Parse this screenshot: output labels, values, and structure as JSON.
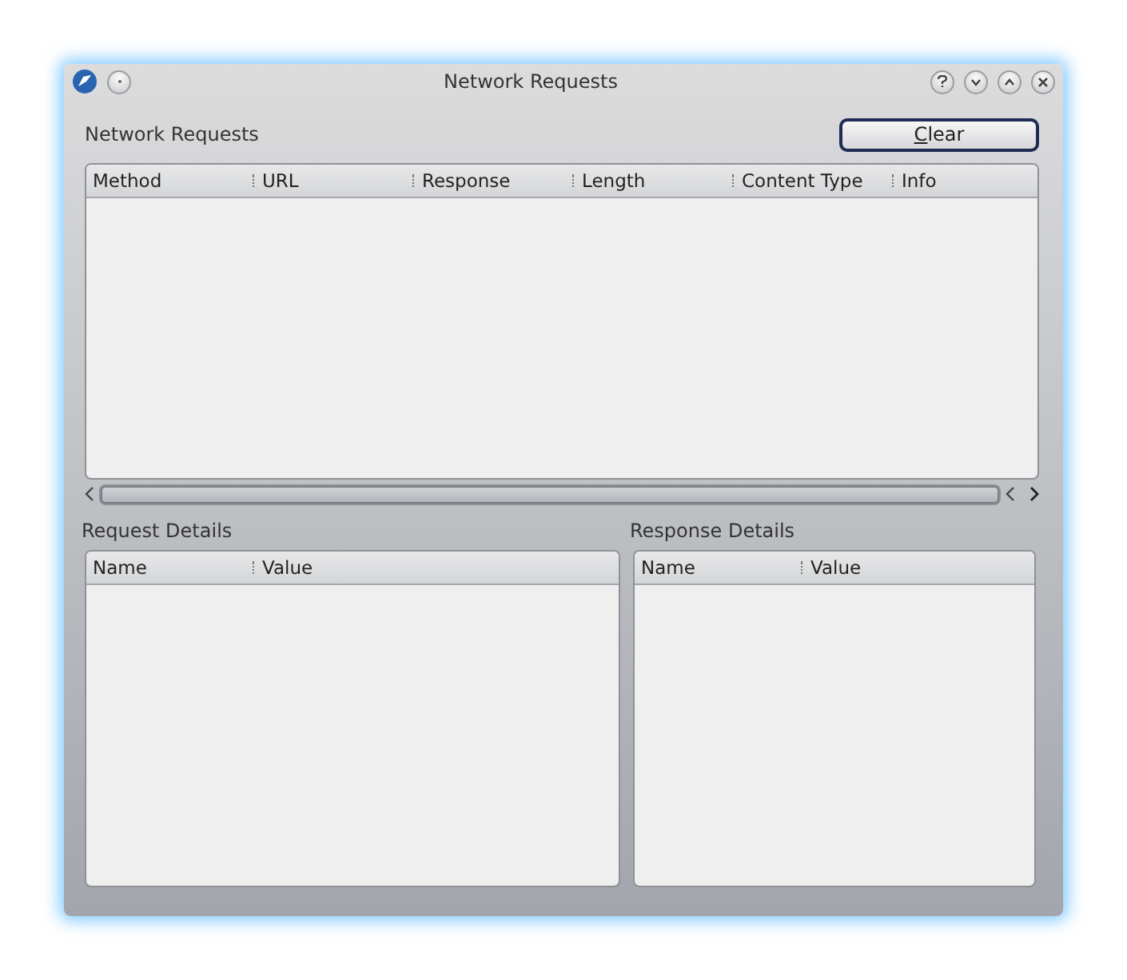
{
  "window": {
    "title": "Network Requests"
  },
  "requests": {
    "label": "Network Requests",
    "clear_button": "Clear",
    "columns": [
      "Method",
      "URL",
      "Response",
      "Length",
      "Content Type",
      "Info"
    ]
  },
  "request_details": {
    "label": "Request Details",
    "columns": [
      "Name",
      "Value"
    ]
  },
  "response_details": {
    "label": "Response Details",
    "columns": [
      "Name",
      "Value"
    ]
  }
}
